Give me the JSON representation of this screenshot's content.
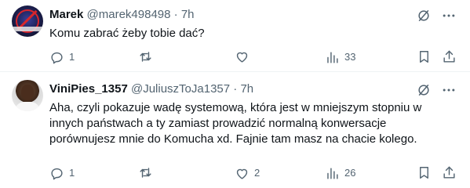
{
  "tweets": [
    {
      "name": "Marek",
      "handle": "@marek498498",
      "separator": "·",
      "time": "7h",
      "text": "Komu zabrać żeby tobie dać?",
      "reply_count": "1",
      "retweet_count": "",
      "like_count": "",
      "view_count": "33"
    },
    {
      "name": "ViniPies_1357",
      "handle": "@JuliuszToJa1357",
      "separator": "·",
      "time": "7h",
      "text": "Aha, czyli pokazuje wadę systemową, która jest w mniejszym stopniu w innych państwach a ty zamiast prowadzić normalną konwersacje porównujesz mnie do Komucha xd. Fajnie tam masz na chacie kolego.",
      "reply_count": "1",
      "retweet_count": "",
      "like_count": "2",
      "view_count": "26"
    }
  ],
  "icons": {
    "grok": "grok-icon",
    "more": "more-icon",
    "reply": "reply-icon",
    "retweet": "retweet-icon",
    "like": "like-icon",
    "views": "views-icon",
    "bookmark": "bookmark-icon",
    "share": "share-icon"
  },
  "colors": {
    "text": "#0f1419",
    "secondary": "#536471",
    "divider": "#eff3f4"
  }
}
